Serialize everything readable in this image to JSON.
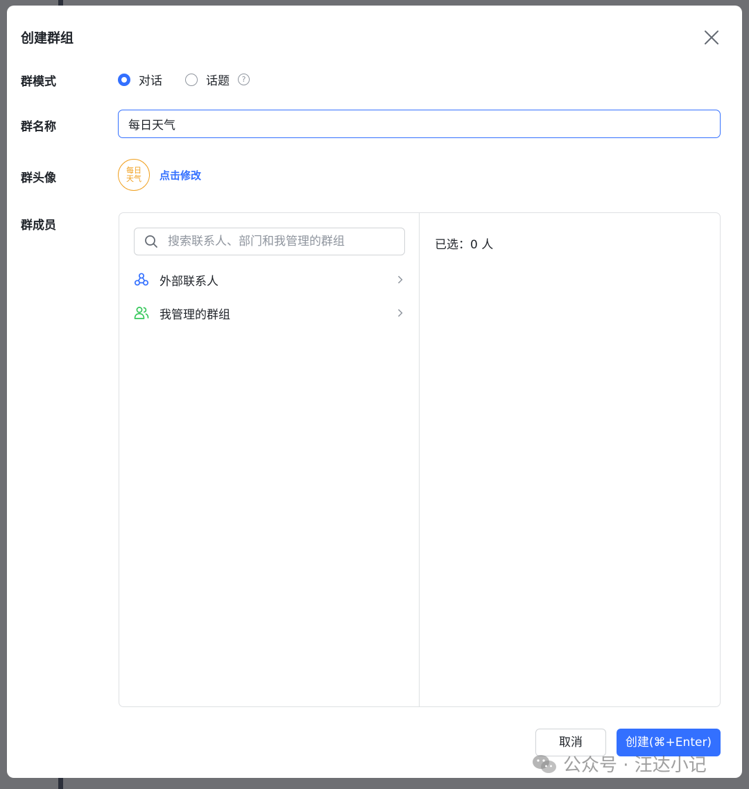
{
  "dialog": {
    "title": "创建群组"
  },
  "mode": {
    "label": "群模式",
    "options": [
      {
        "label": "对话",
        "selected": true
      },
      {
        "label": "话题",
        "selected": false
      }
    ],
    "help_icon": "?"
  },
  "name": {
    "label": "群名称",
    "value": "每日天气"
  },
  "avatar": {
    "label": "群头像",
    "line1": "每日",
    "line2": "天气",
    "edit_link": "点击修改"
  },
  "members": {
    "label": "群成员",
    "search_placeholder": "搜索联系人、部门和我管理的群组",
    "items": [
      {
        "label": "外部联系人",
        "icon": "external-contacts-icon"
      },
      {
        "label": "我管理的群组",
        "icon": "managed-groups-icon"
      }
    ],
    "selected_text": "已选：0 人"
  },
  "footer": {
    "cancel_label": "取消",
    "create_label": "创建(⌘+Enter)"
  },
  "watermark": {
    "text": "公众号 · 汪达小记"
  },
  "colors": {
    "accent": "#3370ff",
    "avatar": "#f0a020",
    "external_icon": "#3370ff",
    "groups_icon": "#34c759"
  }
}
